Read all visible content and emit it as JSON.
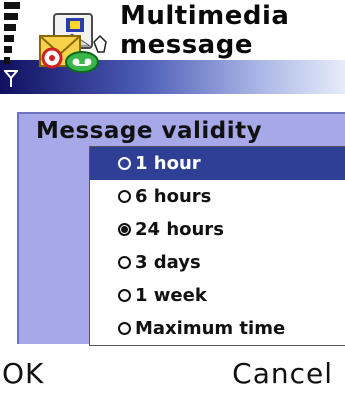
{
  "header": {
    "title_line1": "Multimedia",
    "title_line2": "message",
    "icon": "multimedia-message-icon",
    "signal_icon": "signal-bars-icon",
    "antenna_icon": "antenna-icon"
  },
  "dialog": {
    "title": "Message validity",
    "options": [
      {
        "label": "1 hour",
        "checked": false,
        "highlighted": true
      },
      {
        "label": "6 hours",
        "checked": false,
        "highlighted": false
      },
      {
        "label": "24 hours",
        "checked": true,
        "highlighted": false
      },
      {
        "label": "3 days",
        "checked": false,
        "highlighted": false
      },
      {
        "label": "1 week",
        "checked": false,
        "highlighted": false
      },
      {
        "label": "Maximum time",
        "checked": false,
        "highlighted": false
      }
    ]
  },
  "softkeys": {
    "left": "OK",
    "right": "Cancel"
  },
  "colors": {
    "dialog_bg": "#a6a8e8",
    "highlight": "#2f3f95",
    "header_gradient_dark": "#101060"
  }
}
